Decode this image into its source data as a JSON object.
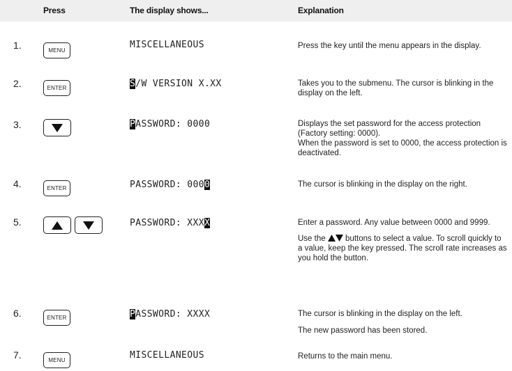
{
  "header": {
    "press": "Press",
    "display": "The display shows...",
    "explanation": "Explanation"
  },
  "icons": {
    "up": "triangle-up-icon",
    "down": "triangle-down-icon"
  },
  "rows": [
    {
      "num": "1.",
      "keys": [
        "MENU"
      ],
      "display_pre": "",
      "display_cursor": "",
      "display_post": "MISCELLANEOUS",
      "expl": [
        "Press the key until the menu appears in the display."
      ]
    },
    {
      "num": "2.",
      "keys": [
        "ENTER"
      ],
      "display_pre": "",
      "display_cursor": "S",
      "display_post": "/W VERSION X.XX",
      "expl": [
        "Takes you to the submenu. The cursor is blinking in the display on the left."
      ]
    },
    {
      "num": "3.",
      "keys": [
        "down"
      ],
      "display_pre": "",
      "display_cursor": "P",
      "display_post": "ASSWORD: 0000",
      "expl": [
        "Displays the set password for the access protection (Factory setting: 0000).",
        "When the password is set to 0000, the access protection is deactivated."
      ]
    },
    {
      "num": "4.",
      "keys": [
        "ENTER"
      ],
      "display_pre": "PASSWORD: 000",
      "display_cursor": "0",
      "display_post": "",
      "expl": [
        "The cursor is blinking in the display on the right."
      ]
    },
    {
      "num": "5.",
      "keys": [
        "up",
        "down"
      ],
      "display_pre": "PASSWORD: XXX",
      "display_cursor": "X",
      "display_post": "",
      "expl": [
        "Enter a password. Any value between 0000 and 9999.",
        "Use the",
        "buttons to select a value. To scroll quickly to a value, keep the key pressed.  The scroll rate increases as you hold the button."
      ]
    },
    {
      "num": "6.",
      "keys": [
        "ENTER"
      ],
      "display_pre": "",
      "display_cursor": "P",
      "display_post": "ASSWORD: XXXX",
      "expl": [
        "The cursor is blinking in the display on the left.",
        "The new password has been stored."
      ]
    },
    {
      "num": "7.",
      "keys": [
        "MENU"
      ],
      "display_pre": "",
      "display_cursor": "",
      "display_post": "MISCELLANEOUS",
      "expl": [
        "Returns to the main menu."
      ]
    }
  ]
}
